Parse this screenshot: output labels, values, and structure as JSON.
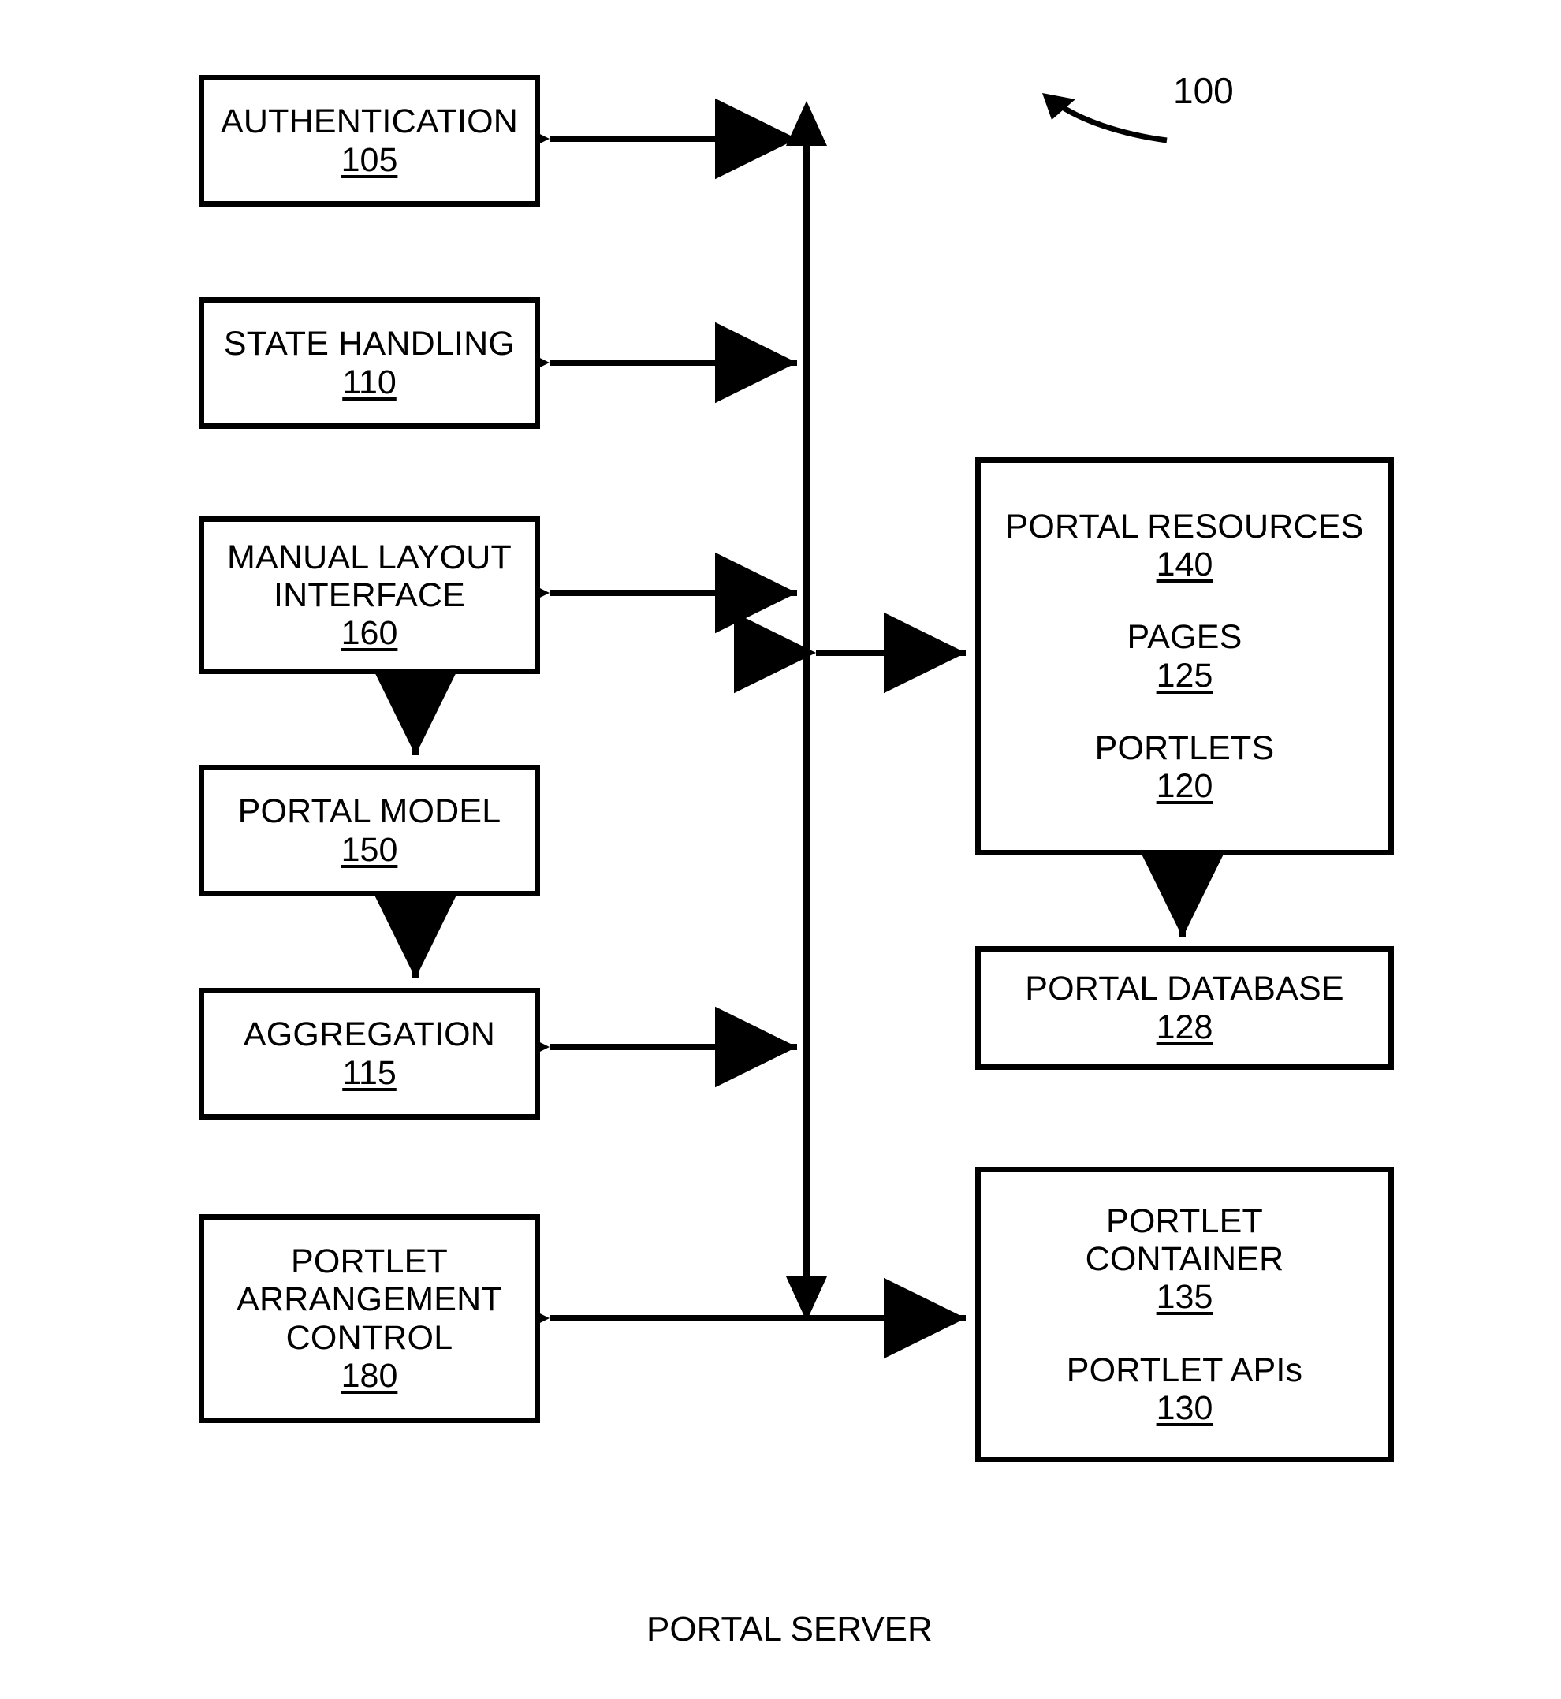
{
  "figure": {
    "figure_label": "100",
    "caption": "PORTAL SERVER"
  },
  "left_column": {
    "boxes": [
      {
        "name": "authentication",
        "lines": [
          "AUTHENTICATION"
        ],
        "ref": "105"
      },
      {
        "name": "state-handling",
        "lines": [
          "STATE HANDLING"
        ],
        "ref": "110"
      },
      {
        "name": "manual-layout-interface",
        "lines": [
          "MANUAL LAYOUT",
          "INTERFACE"
        ],
        "ref": "160"
      },
      {
        "name": "portal-model",
        "lines": [
          "PORTAL MODEL"
        ],
        "ref": "150"
      },
      {
        "name": "aggregation",
        "lines": [
          "AGGREGATION"
        ],
        "ref": "115"
      },
      {
        "name": "portlet-arrangement-control",
        "lines": [
          "PORTLET",
          "ARRANGEMENT",
          "CONTROL"
        ],
        "ref": "180"
      }
    ]
  },
  "right_column": {
    "boxes": [
      {
        "name": "portal-resources",
        "groups": [
          {
            "lines": [
              "PORTAL RESOURCES"
            ],
            "ref": "140"
          },
          {
            "lines": [
              "PAGES"
            ],
            "ref": "125"
          },
          {
            "lines": [
              "PORTLETS"
            ],
            "ref": "120"
          }
        ]
      },
      {
        "name": "portal-database",
        "groups": [
          {
            "lines": [
              "PORTAL DATABASE"
            ],
            "ref": "128"
          }
        ]
      },
      {
        "name": "portlet-container",
        "groups": [
          {
            "lines": [
              "PORTLET",
              "CONTAINER"
            ],
            "ref": "135"
          },
          {
            "lines": [
              "PORTLET APIs"
            ],
            "ref": "130"
          }
        ]
      }
    ]
  },
  "colors": {
    "stroke": "#000000",
    "fill": "#ffffff"
  }
}
